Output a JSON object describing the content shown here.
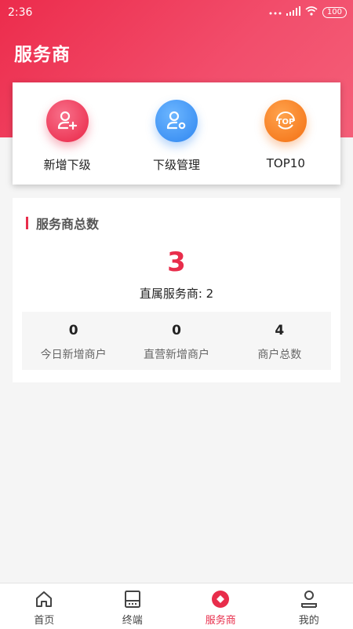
{
  "status_bar": {
    "time": "2:36",
    "battery": "100"
  },
  "header": {
    "title": "服务商"
  },
  "actions": [
    {
      "label": "新增下级",
      "icon": "add-user-icon",
      "color": "#e92546"
    },
    {
      "label": "下级管理",
      "icon": "user-settings-icon",
      "color": "#2f86f0"
    },
    {
      "label": "TOP10",
      "icon": "top-badge-icon",
      "icon_text": "TOP",
      "color": "#f36f12"
    }
  ],
  "summary": {
    "title": "服务商总数",
    "total": "3",
    "direct_label": "直属服务商",
    "direct_value": "2",
    "direct_text": "直属服务商: 2",
    "metrics": [
      {
        "value": "0",
        "label": "今日新增商户"
      },
      {
        "value": "0",
        "label": "直营新增商户"
      },
      {
        "value": "4",
        "label": "商户总数"
      }
    ]
  },
  "tabs": [
    {
      "label": "首页",
      "icon": "home-icon",
      "active": false
    },
    {
      "label": "终端",
      "icon": "terminal-icon",
      "active": false
    },
    {
      "label": "服务商",
      "icon": "provider-icon",
      "active": true
    },
    {
      "label": "我的",
      "icon": "profile-icon",
      "active": false
    }
  ],
  "colors": {
    "accent": "#e82d4b"
  }
}
